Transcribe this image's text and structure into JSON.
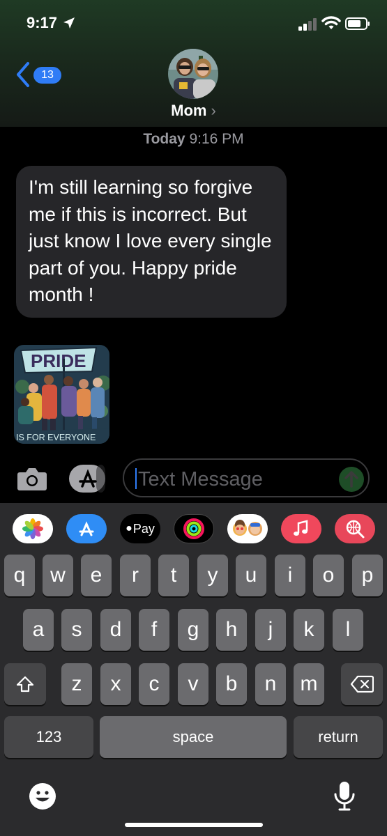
{
  "status_bar": {
    "time": "9:17"
  },
  "nav": {
    "unread_count": "13",
    "contact_name": "Mom",
    "chevron": "›"
  },
  "thread": {
    "timestamp_day": "Today",
    "timestamp_time": "9:16 PM",
    "message_text": "I'm still learning so forgive me if this is incorrect.  But  just know I love every single part of you.  Happy pride month !",
    "sticker": {
      "title": "PRIDE",
      "caption": "IS FOR EVERYONE"
    }
  },
  "compose": {
    "placeholder": "Text Message"
  },
  "app_strip": {
    "apple_pay_label": "Pay"
  },
  "keyboard": {
    "row1": [
      "q",
      "w",
      "e",
      "r",
      "t",
      "y",
      "u",
      "i",
      "o",
      "p"
    ],
    "row2": [
      "a",
      "s",
      "d",
      "f",
      "g",
      "h",
      "j",
      "k",
      "l"
    ],
    "row3": [
      "z",
      "x",
      "c",
      "v",
      "b",
      "n",
      "m"
    ],
    "numbers_label": "123",
    "space_label": "space",
    "return_label": "return"
  },
  "colors": {
    "accent": "#2f7cf6",
    "incoming_bubble": "#262629",
    "keyboard_bg": "#2b2b2d",
    "key": "#6b6b6e"
  }
}
